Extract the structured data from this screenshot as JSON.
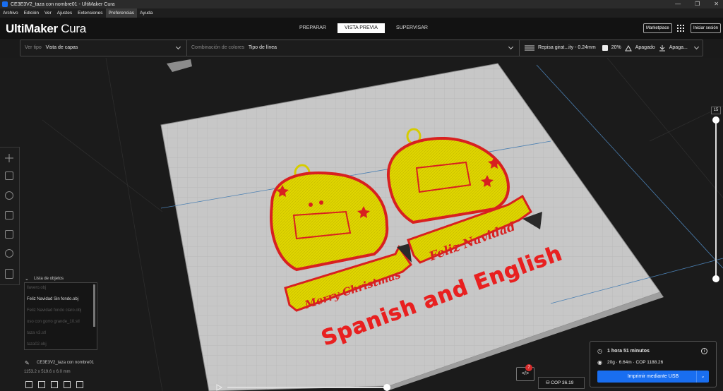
{
  "window": {
    "title": "CE3E3V2_taza con nombre01 - UltiMaker Cura",
    "controls": [
      "—",
      "❐",
      "✕"
    ]
  },
  "menu": [
    "Archivo",
    "Edición",
    "Ver",
    "Ajustes",
    "Extensiones",
    "Preferencias",
    "Ayuda"
  ],
  "brand": {
    "bold": "UltiMaker",
    "light": " Cura"
  },
  "stages": [
    "PREPARAR",
    "VISTA PREVIA",
    "SUPERVISAR"
  ],
  "header": {
    "marketplace": "Marketplace",
    "signin": "Iniciar sesión"
  },
  "toolbar": {
    "view_type_label": "Ver tipo",
    "view_type_value": "Vista de capas",
    "color_label": "Combinación de colores",
    "color_value": "Tipo de línea",
    "profile": "Repisa girat...ity - 0.24mm",
    "infill": "20%",
    "support": "Apagado",
    "adhesion": "Apaga..."
  },
  "scene": {
    "left_ornament_text": "Merry Christmas",
    "right_ornament_text": "Feliz Navidad",
    "overlay_text": "Spanish and English"
  },
  "objects": {
    "title": "Lista de objetos",
    "items": [
      "llavero.obj",
      "Feliz Navidad Sin fondo.obj",
      "Feliz Navidad fondo claro.obj",
      "oso con gorro grande_10.stl",
      "taza v3.stl",
      "taza02.obj"
    ],
    "selected_index": 1,
    "file_name": "CE3E3V2_taza con nombre01",
    "dimensions": "1153.2 x 519.6 x 6.0 mm"
  },
  "layer": {
    "current": "15"
  },
  "print": {
    "time": "1 hora 51 minutos",
    "material": "20g · 6.64m · COP 1188.26",
    "button": "Imprimir mediante USB",
    "cop": "COP 36.19",
    "badge": "7"
  },
  "colors": {
    "accent": "#196ef0",
    "ornament_fill": "#e0d600",
    "ornament_edge": "#d82020",
    "text_red": "#e82020",
    "bed": "#c8c8c8"
  }
}
